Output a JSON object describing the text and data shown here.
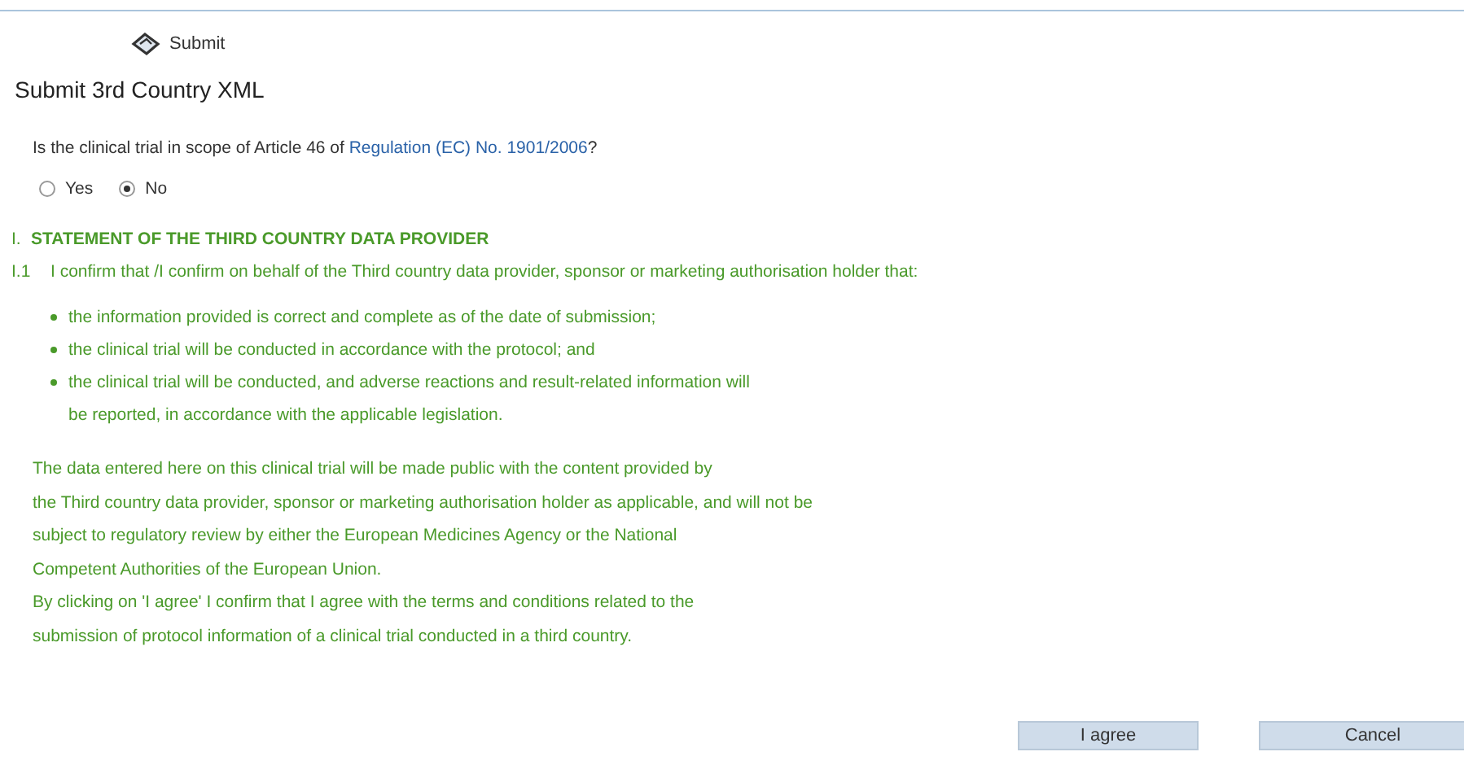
{
  "toolbar": {
    "submit_label": "Submit"
  },
  "title": "Submit 3rd Country XML",
  "question": {
    "text": "Is the clinical trial in scope of Article 46 of ",
    "link": "Regulation (EC) No. 1901/2006",
    "end": "?"
  },
  "options": [
    {
      "label": "Yes",
      "selected": false
    },
    {
      "label": "No",
      "selected": true
    }
  ],
  "section": {
    "number": "I.",
    "heading": "STATEMENT OF THE THIRD COUNTRY DATA PROVIDER"
  },
  "clause": {
    "number": "I.1",
    "text": "I confirm that /I confirm on behalf of the Third country data provider, sponsor or marketing authorisation holder that:"
  },
  "bullets": [
    {
      "lines": [
        "the information provided is correct and complete as of the date of submission;"
      ]
    },
    {
      "lines": [
        "the clinical trial will be conducted in accordance with the protocol; and"
      ]
    },
    {
      "lines": [
        "the clinical trial will be conducted, and adverse reactions and result-related information will",
        "be reported, in accordance with the applicable legislation."
      ]
    }
  ],
  "notice": [
    "The data entered here on this clinical trial will be made public with the content provided by",
    "the Third country data provider, sponsor or marketing authorisation holder as applicable, and will not be",
    "subject to regulatory review by either the European Medicines Agency or the National",
    "Competent Authorities of the European Union.",
    "By clicking on 'I agree' I confirm that I agree with the terms and conditions related to the",
    "submission of protocol information of a clinical trial conducted in a third country."
  ],
  "buttons": [
    {
      "label": "I agree"
    },
    {
      "label": "Cancel"
    }
  ]
}
